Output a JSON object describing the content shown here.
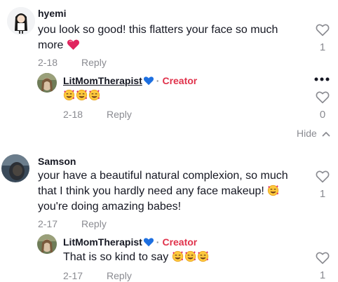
{
  "comments": [
    {
      "username": "hyemi",
      "text": "you look so good! this flatters your face so much more",
      "emoji": "❤️",
      "date": "2-18",
      "reply_label": "Reply",
      "likes": "1",
      "replies": [
        {
          "username": "LitMomTherapist",
          "badge": "Creator",
          "text": "",
          "emoji": "🥰🥰🥰",
          "date": "2-18",
          "reply_label": "Reply",
          "likes": "0"
        }
      ],
      "hide_label": "Hide"
    },
    {
      "username": "Samson",
      "text": "your have a beautiful natural complexion, so much that I think you hardly need any face makeup!",
      "text_line3": "you're doing amazing babes!",
      "emoji": "🥰",
      "date": "2-17",
      "reply_label": "Reply",
      "likes": "1",
      "replies": [
        {
          "username": "LitMomTherapist",
          "badge": "Creator",
          "text": "That is so kind to say",
          "emoji": "🥰🥰🥰",
          "date": "2-17",
          "reply_label": "Reply",
          "likes": "1"
        }
      ]
    }
  ],
  "colors": {
    "creator": "#e0324b",
    "meta": "#8a8b91",
    "heart_red": "#e0245e",
    "heart_blue": "#1d6fe0"
  },
  "icons": {
    "like": "heart-outline-icon",
    "more": "more-horizontal-icon",
    "hide": "chevron-up-icon"
  }
}
